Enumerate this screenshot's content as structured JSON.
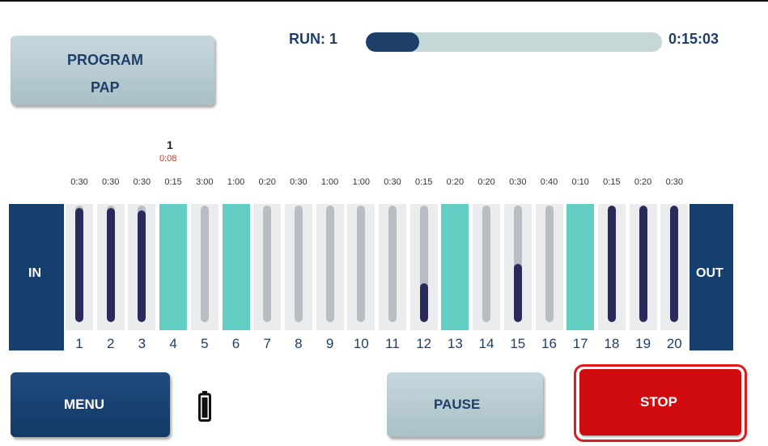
{
  "program": {
    "line1": "PROGRAM",
    "line2": "PAP"
  },
  "run": {
    "label": "RUN: 1",
    "progress": 0.18,
    "time": "0:15:03"
  },
  "current_step": {
    "marker": "1",
    "elapsed": "0:08"
  },
  "inlet_label": "IN",
  "outlet_label": "OUT",
  "stations": [
    {
      "number": "1",
      "duration": "0:30",
      "fill": 0.98,
      "active": false
    },
    {
      "number": "2",
      "duration": "0:30",
      "fill": 0.98,
      "active": false
    },
    {
      "number": "3",
      "duration": "0:30",
      "fill": 0.96,
      "active": false
    },
    {
      "number": "4",
      "duration": "0:15",
      "fill": 0,
      "active": true
    },
    {
      "number": "5",
      "duration": "3:00",
      "fill": 0,
      "active": false
    },
    {
      "number": "6",
      "duration": "1:00",
      "fill": 0,
      "active": true
    },
    {
      "number": "7",
      "duration": "0:20",
      "fill": 0,
      "active": false
    },
    {
      "number": "8",
      "duration": "0:30",
      "fill": 0,
      "active": false
    },
    {
      "number": "9",
      "duration": "1:00",
      "fill": 0,
      "active": false
    },
    {
      "number": "10",
      "duration": "1:00",
      "fill": 0,
      "active": false
    },
    {
      "number": "11",
      "duration": "0:30",
      "fill": 0,
      "active": false
    },
    {
      "number": "12",
      "duration": "0:15",
      "fill": 0.33,
      "active": false
    },
    {
      "number": "13",
      "duration": "0:20",
      "fill": 0,
      "active": true
    },
    {
      "number": "14",
      "duration": "0:20",
      "fill": 0,
      "active": false
    },
    {
      "number": "15",
      "duration": "0:30",
      "fill": 0.5,
      "active": false
    },
    {
      "number": "16",
      "duration": "0:40",
      "fill": 0,
      "active": false
    },
    {
      "number": "17",
      "duration": "0:10",
      "fill": 0,
      "active": true
    },
    {
      "number": "18",
      "duration": "0:15",
      "fill": 1,
      "active": false
    },
    {
      "number": "19",
      "duration": "0:20",
      "fill": 1,
      "active": false
    },
    {
      "number": "20",
      "duration": "0:30",
      "fill": 1,
      "active": false
    }
  ],
  "buttons": {
    "menu": "MENU",
    "pause": "PAUSE",
    "stop": "STOP"
  },
  "icons": {
    "battery": "battery-icon"
  },
  "colors": {
    "navy": "#173f6e",
    "teal": "#62cec4",
    "stop_red": "#cf0b0f",
    "button_gray": "#b4c8cd"
  }
}
